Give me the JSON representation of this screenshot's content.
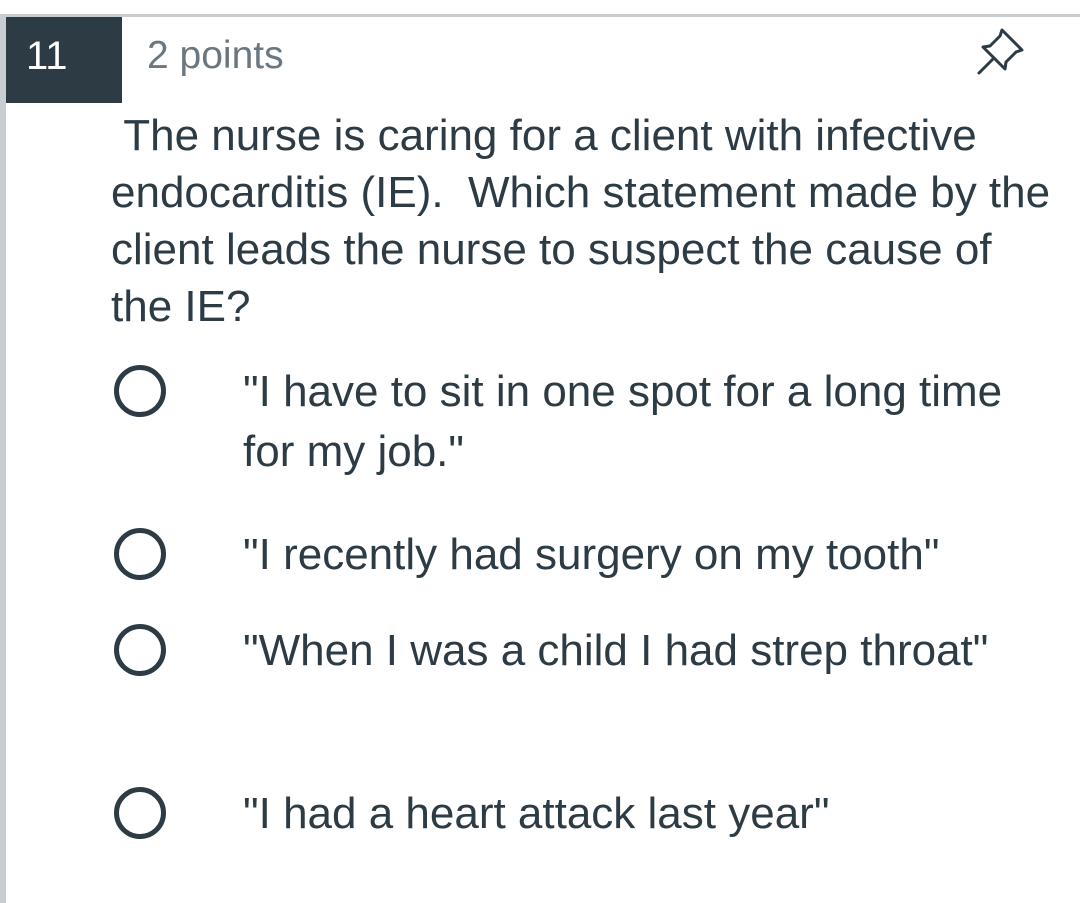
{
  "question": {
    "number": "11",
    "points": "2 points",
    "pin_icon": "pin-icon",
    "text": " The nurse is caring for a client with infective endocarditis (IE).  Which statement made by the client leads the nurse to suspect the cause of the IE?"
  },
  "answers": [
    {
      "label": "\"I have to sit in one spot for a long time for my job.\""
    },
    {
      "label": "\"I recently had surgery on my tooth\""
    },
    {
      "label": "\"When I was a child I had strep throat\""
    },
    {
      "label": "\"I had a heart attack last year\""
    }
  ],
  "colors": {
    "header_bg": "#2d3b45",
    "text": "#2d3b45",
    "muted_text": "#6b7780",
    "border": "#c7cdd1"
  }
}
